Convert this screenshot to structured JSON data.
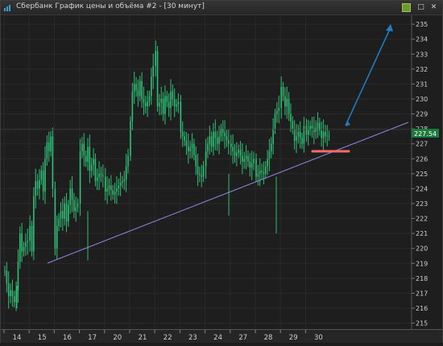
{
  "window": {
    "title": "Сбербанк График цены и объёма #2 - [30 минут]",
    "buttons": {
      "restore": "□",
      "close": "✕"
    }
  },
  "colors": {
    "background": "#1e1e1e",
    "candles": "#2fbf76",
    "trendline": "#8a86e0",
    "arrow": "#1e7fc8",
    "support_mark": "#ff6b6b",
    "price_tag": "#1b7a3e"
  },
  "price_axis": {
    "ticks": [
      "235",
      "234",
      "233",
      "232",
      "231",
      "230",
      "229",
      "228",
      "227",
      "226",
      "225",
      "224",
      "223",
      "222",
      "221",
      "220",
      "219",
      "218",
      "217",
      "216",
      "215"
    ],
    "current_price": "227.54"
  },
  "time_axis": {
    "ticks": [
      "14",
      "15",
      "16",
      "17",
      "20",
      "21",
      "22",
      "23",
      "24",
      "27",
      "28",
      "29",
      "30"
    ]
  },
  "chart_data": {
    "type": "candlestick",
    "ylim": [
      214.6,
      235.6
    ],
    "segments": [
      {
        "day": "14",
        "points": [
          [
            0,
            218.5
          ],
          [
            2,
            216.8
          ],
          [
            3,
            217.2
          ],
          [
            5,
            216.4
          ],
          [
            6,
            217.2
          ],
          [
            8,
            221.0
          ],
          [
            9,
            219.8
          ],
          [
            11,
            220.4
          ],
          [
            12,
            220.5
          ]
        ]
      },
      {
        "day": "15",
        "points": [
          [
            0,
            221.5
          ],
          [
            1,
            219.8
          ],
          [
            2,
            223.5
          ],
          [
            3,
            224.5
          ],
          [
            4,
            224.0
          ],
          [
            6,
            225.2
          ],
          [
            7,
            223.8
          ],
          [
            8,
            226.0
          ],
          [
            9,
            227.1
          ],
          [
            10,
            226.5
          ],
          [
            11,
            227.5
          ],
          [
            12,
            224.0
          ]
        ]
      },
      {
        "day": "16",
        "points": [
          [
            0,
            220.0
          ],
          [
            1,
            221.5
          ],
          [
            3,
            222.5
          ],
          [
            4,
            222.0
          ],
          [
            5,
            223.0
          ],
          [
            6,
            221.8
          ],
          [
            8,
            224.0
          ],
          [
            10,
            222.5
          ],
          [
            12,
            223.0
          ]
        ]
      },
      {
        "day": "17",
        "points": [
          [
            0,
            226.5
          ],
          [
            1,
            227.0
          ],
          [
            2,
            226.2
          ],
          [
            3,
            225.8
          ],
          [
            4,
            226.8
          ],
          [
            5,
            225.2
          ],
          [
            7,
            226.0
          ],
          [
            8,
            224.5
          ],
          [
            10,
            225.0
          ],
          [
            12,
            224.8
          ]
        ]
      },
      {
        "day": "20",
        "points": [
          [
            0,
            223.8
          ],
          [
            2,
            224.2
          ],
          [
            4,
            223.6
          ],
          [
            6,
            224.0
          ],
          [
            8,
            224.4
          ],
          [
            10,
            224.6
          ],
          [
            11,
            225.5
          ],
          [
            12,
            226.2
          ]
        ]
      },
      {
        "day": "21",
        "points": [
          [
            0,
            228.5
          ],
          [
            1,
            230.5
          ],
          [
            2,
            231.0
          ],
          [
            4,
            230.2
          ],
          [
            5,
            231.2
          ],
          [
            6,
            230.0
          ],
          [
            8,
            229.5
          ],
          [
            10,
            230.2
          ],
          [
            11,
            231.5
          ],
          [
            12,
            232.2
          ]
        ]
      },
      {
        "day": "22",
        "points": [
          [
            0,
            233.2
          ],
          [
            1,
            229.5
          ],
          [
            3,
            230.0
          ],
          [
            4,
            229.0
          ],
          [
            5,
            230.2
          ],
          [
            7,
            229.4
          ],
          [
            8,
            230.5
          ],
          [
            10,
            229.5
          ],
          [
            12,
            229.8
          ]
        ]
      },
      {
        "day": "23",
        "points": [
          [
            0,
            227.8
          ],
          [
            2,
            227.2
          ],
          [
            4,
            226.5
          ],
          [
            6,
            227.0
          ],
          [
            8,
            225.5
          ],
          [
            9,
            225.0
          ],
          [
            11,
            224.8
          ],
          [
            12,
            225.5
          ]
        ]
      },
      {
        "day": "24",
        "points": [
          [
            0,
            226.5
          ],
          [
            2,
            227.5
          ],
          [
            3,
            226.8
          ],
          [
            4,
            227.8
          ],
          [
            6,
            227.0
          ],
          [
            8,
            228.0
          ],
          [
            10,
            227.5
          ],
          [
            12,
            227.0
          ]
        ]
      },
      {
        "day": "27",
        "points": [
          [
            0,
            226.8
          ],
          [
            2,
            226.2
          ],
          [
            4,
            226.6
          ],
          [
            6,
            225.8
          ],
          [
            8,
            226.2
          ],
          [
            10,
            225.4
          ],
          [
            12,
            226.0
          ]
        ]
      },
      {
        "day": "28",
        "points": [
          [
            0,
            224.8
          ],
          [
            2,
            225.2
          ],
          [
            4,
            225.0
          ],
          [
            6,
            226.0
          ],
          [
            8,
            227.0
          ],
          [
            10,
            229.0
          ],
          [
            12,
            229.4
          ]
        ]
      },
      {
        "day": "29",
        "points": [
          [
            0,
            230.8
          ],
          [
            1,
            230.2
          ],
          [
            2,
            229.5
          ],
          [
            3,
            230.0
          ],
          [
            4,
            229.0
          ],
          [
            6,
            228.0
          ],
          [
            7,
            227.2
          ],
          [
            9,
            227.8
          ],
          [
            11,
            227.0
          ],
          [
            12,
            228.2
          ]
        ]
      },
      {
        "day": "30",
        "points": [
          [
            0,
            227.6
          ],
          [
            2,
            228.2
          ],
          [
            4,
            227.8
          ],
          [
            6,
            228.4
          ],
          [
            8,
            227.4
          ],
          [
            9,
            227.8
          ],
          [
            10,
            227.54
          ]
        ]
      }
    ]
  }
}
